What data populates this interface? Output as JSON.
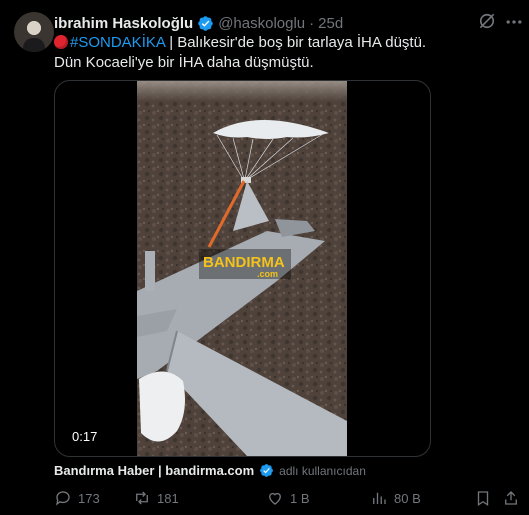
{
  "author": {
    "name": "ibrahim Haskoloğlu",
    "handle": "@haskologlu",
    "separator": "·",
    "time": "25d"
  },
  "tweet": {
    "hashtag": "#SONDAKİKA",
    "line1_rest": " | Balıkesir'de boş bir tarlaya İHA düştü.",
    "line2": "Dün Kocaeli'ye bir İHA daha düşmüştü."
  },
  "media": {
    "duration": "0:17",
    "watermark": "BANDIRMA",
    "watermark_sub": ".com"
  },
  "source": {
    "name": "Bandırma Haber | bandirma.com",
    "note": "adlı kullanıcıdan"
  },
  "actions": {
    "replies": "173",
    "reposts": "181",
    "likes": "1 B",
    "views": "80 B"
  },
  "icons": [
    "grok-icon",
    "more-icon",
    "verified-icon",
    "reply-icon",
    "repost-icon",
    "like-icon",
    "views-icon",
    "bookmark-icon",
    "share-icon"
  ],
  "colors": {
    "accent": "#1d9bf0",
    "muted": "#71767b",
    "text": "#e7e9ea",
    "background": "#000000",
    "alert_dot": "#e0242f"
  }
}
